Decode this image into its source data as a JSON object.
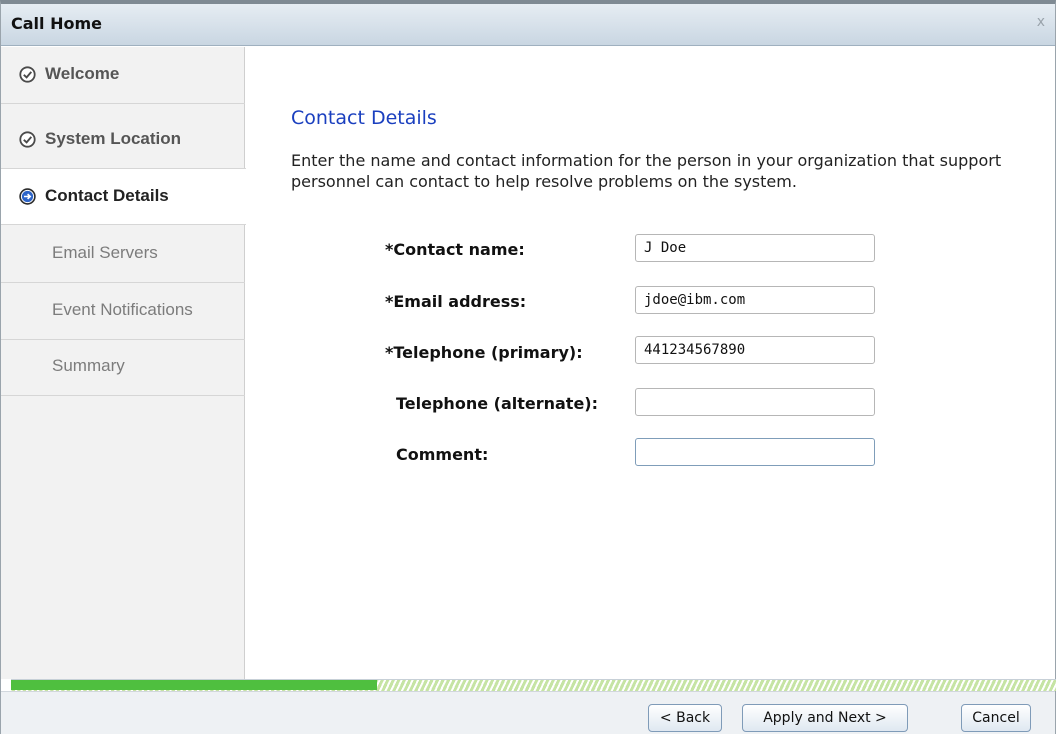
{
  "window": {
    "title": "Call Home",
    "close_label": "x"
  },
  "sidebar": {
    "items": [
      {
        "label": "Welcome",
        "state": "done",
        "icon": "check-circle-icon"
      },
      {
        "label": "System Location",
        "state": "done",
        "icon": "check-circle-icon"
      },
      {
        "label": "Contact Details",
        "state": "current",
        "icon": "arrow-circle-icon"
      },
      {
        "label": "Email Servers",
        "state": "todo"
      },
      {
        "label": "Event Notifications",
        "state": "todo"
      },
      {
        "label": "Summary",
        "state": "todo"
      }
    ]
  },
  "main": {
    "heading": "Contact Details",
    "description": "Enter the name and contact information for the person in your organization that support personnel can contact to help resolve problems on the system.",
    "fields": [
      {
        "label": "*Contact name:",
        "value": "J Doe"
      },
      {
        "label": "*Email address:",
        "value": "jdoe@ibm.com"
      },
      {
        "label": "*Telephone (primary):",
        "value": "441234567890"
      },
      {
        "label": "Telephone (alternate):",
        "value": ""
      },
      {
        "label": "Comment:",
        "value": ""
      }
    ]
  },
  "progress": {
    "percent": 35
  },
  "footer": {
    "back_label": "< Back",
    "next_label": "Apply and Next >",
    "cancel_label": "Cancel"
  },
  "colors": {
    "heading": "#1a3fbf",
    "progress_fill": "#4fbf3f",
    "check_icon": "#4a4a4a",
    "arrow_icon": "#2d64c8"
  }
}
